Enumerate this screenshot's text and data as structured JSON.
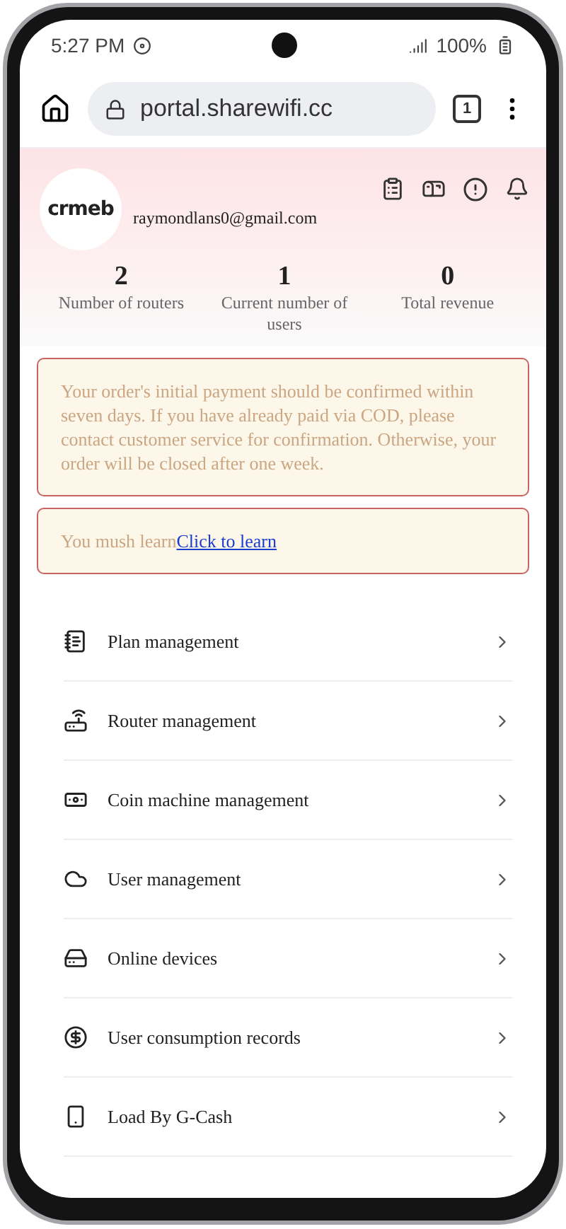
{
  "status_bar": {
    "time": "5:27 PM",
    "battery": "100%"
  },
  "browser": {
    "url": "portal.sharewifi.cc",
    "tab_count": "1"
  },
  "profile": {
    "logo": "crmeb",
    "email": "raymondlans0@gmail.com"
  },
  "stats": [
    {
      "value": "2",
      "label": "Number of routers"
    },
    {
      "value": "1",
      "label": "Current number of users"
    },
    {
      "value": "0",
      "label": "Total revenue"
    }
  ],
  "notices": [
    {
      "text": "Your order's initial payment should be confirmed within seven days. If you have already paid via COD, please contact customer service for confirmation. Otherwise, your order will be closed after one week."
    },
    {
      "text": "You mush learn",
      "link": "Click to learn"
    }
  ],
  "menu": [
    {
      "label": "Plan management"
    },
    {
      "label": "Router management"
    },
    {
      "label": "Coin machine management"
    },
    {
      "label": "User management"
    },
    {
      "label": "Online devices"
    },
    {
      "label": "User consumption records"
    },
    {
      "label": "Load By G-Cash"
    }
  ]
}
